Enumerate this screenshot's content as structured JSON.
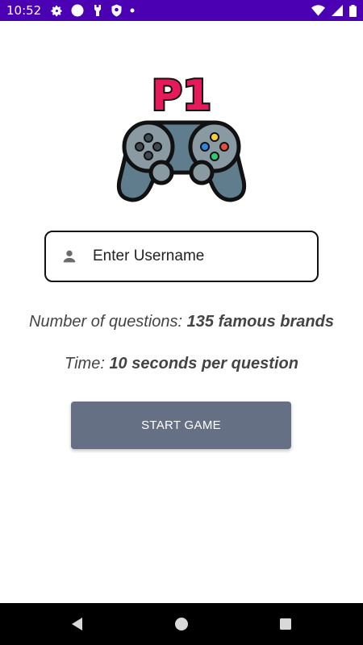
{
  "status_bar": {
    "time": "10:52",
    "background_color": "#4b00b3",
    "left_icons": [
      "gear-icon",
      "circle-icon",
      "usb-icon",
      "shield-icon",
      "dot-icon"
    ],
    "right_icons": [
      "wifi-icon",
      "signal-icon",
      "battery-icon"
    ]
  },
  "logo": {
    "text": "P1",
    "text_color": "#e8195a",
    "controller_color": "#5f7d8c"
  },
  "username": {
    "placeholder": "Enter Username",
    "value": ""
  },
  "info": {
    "questions_label": "Number of questions: ",
    "questions_value": "135 famous brands",
    "time_label": "Time: ",
    "time_value": "10 seconds per question"
  },
  "start_button": {
    "label": "START GAME",
    "color": "#667085"
  },
  "nav_bar": {
    "buttons": [
      "back-icon",
      "home-icon",
      "recents-icon"
    ]
  }
}
